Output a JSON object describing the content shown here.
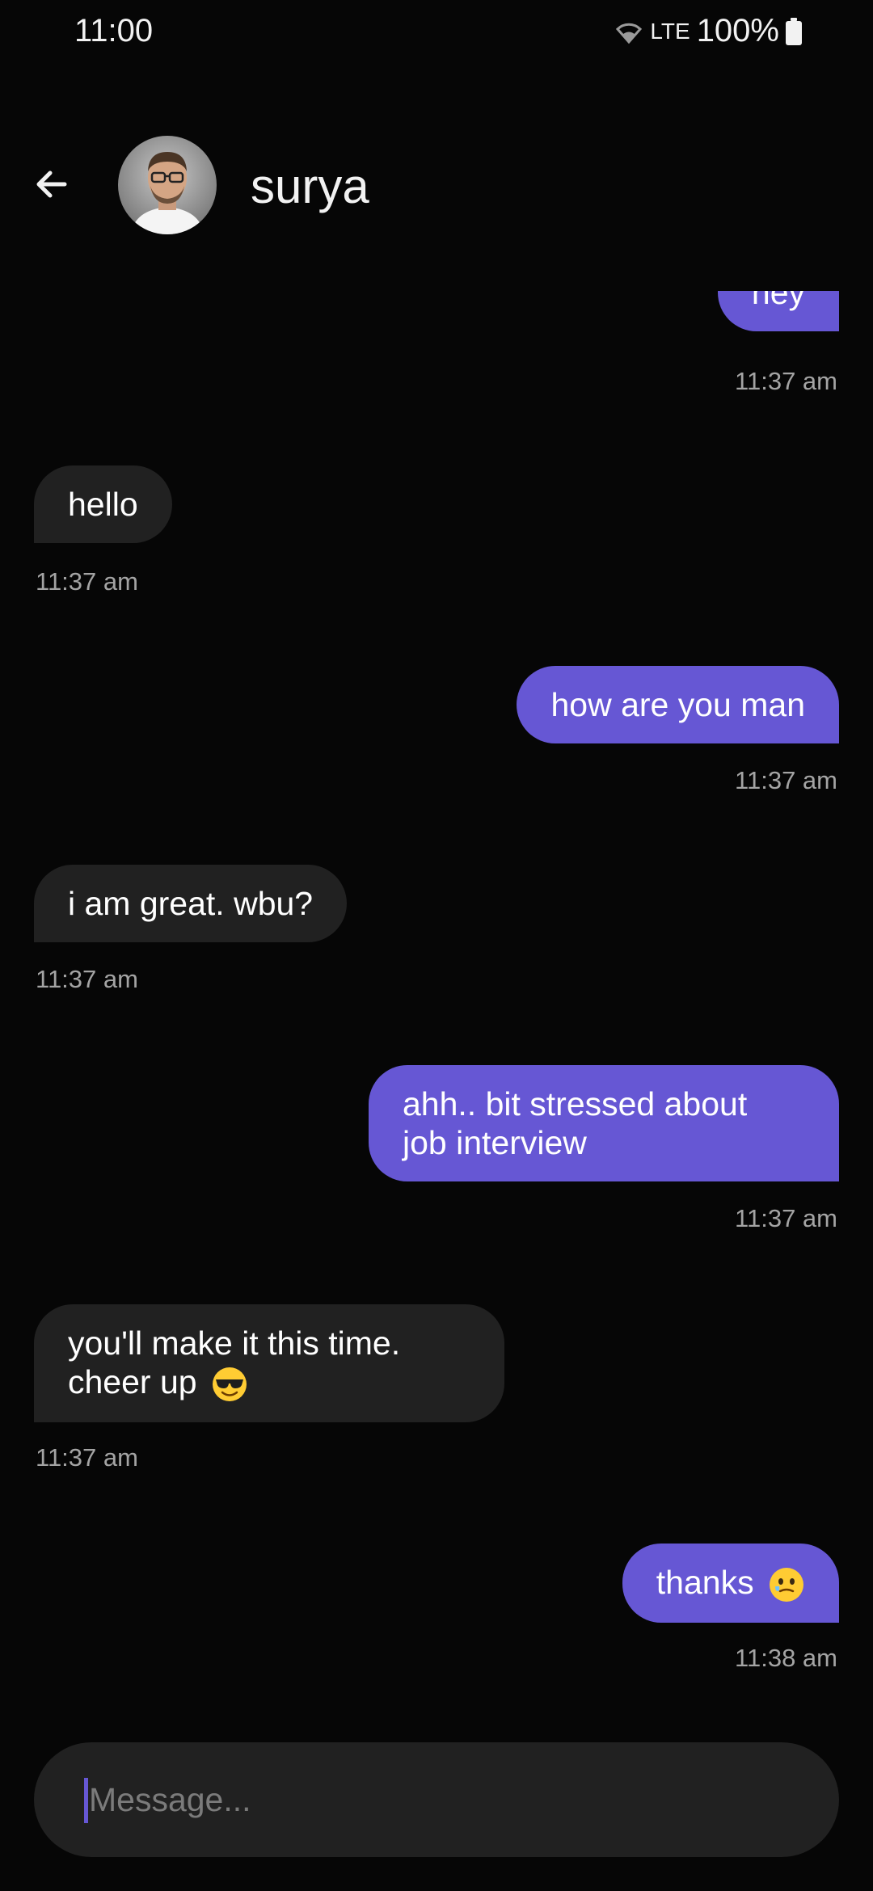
{
  "status_bar": {
    "time": "11:00",
    "network": "LTE",
    "battery": "100%"
  },
  "header": {
    "contact_name": "surya"
  },
  "messages": [
    {
      "direction": "sent",
      "text": "hey",
      "time": "11:37 am"
    },
    {
      "direction": "received",
      "text": "hello",
      "time": "11:37 am"
    },
    {
      "direction": "sent",
      "text": "how are you man",
      "time": "11:37 am"
    },
    {
      "direction": "received",
      "text": "i am great. wbu?",
      "time": "11:37 am"
    },
    {
      "direction": "sent",
      "text_lines": [
        "ahh.. bit stressed about",
        "job interview"
      ],
      "time": "11:37 am"
    },
    {
      "direction": "received",
      "text_lines": [
        "you'll make it this time.",
        "cheer up"
      ],
      "emoji": "smiling-face-with-sunglasses",
      "time": "11:37 am"
    },
    {
      "direction": "sent",
      "text": "thanks",
      "emoji": "face-holding-back-tears",
      "time": "11:38 am"
    }
  ],
  "composer": {
    "placeholder": "Message..."
  },
  "colors": {
    "sent_bubble": "#6657d4",
    "received_bubble": "#212121",
    "background": "#060606"
  }
}
